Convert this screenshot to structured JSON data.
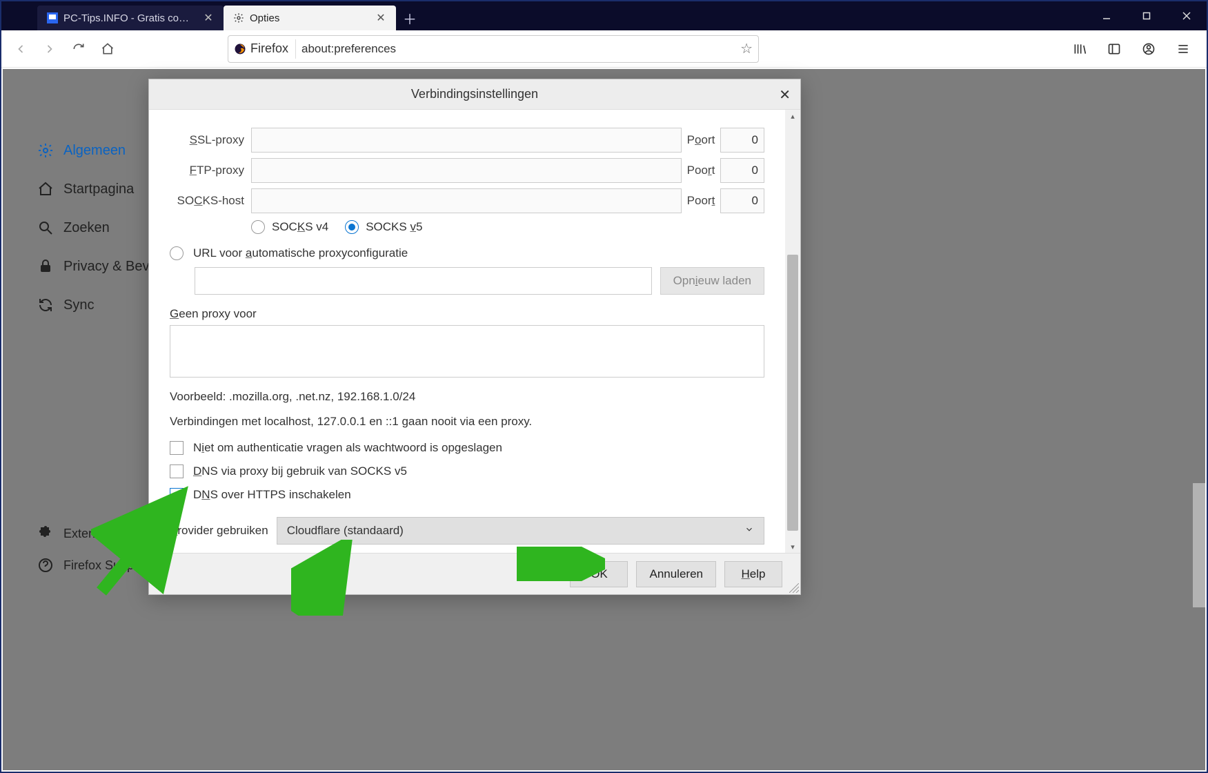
{
  "tabs": {
    "t1": {
      "title": "PC-Tips.INFO - Gratis compute"
    },
    "t2": {
      "title": "Opties"
    }
  },
  "urlbar": {
    "identity": "Firefox",
    "url": "about:preferences"
  },
  "sidebar": {
    "general": "Algemeen",
    "home": "Startpagina",
    "search": "Zoeken",
    "privacy": "Privacy & Beve",
    "sync": "Sync",
    "extensions": "Extensies & T",
    "support": "Firefox Support"
  },
  "dialog": {
    "title": "Verbindingsinstellingen",
    "ssl_label": "SSL-proxy",
    "ftp_label": "FTP-proxy",
    "socks_label": "SOCKS-host",
    "port_label": "Poort",
    "port_ssl": "0",
    "port_ftp": "0",
    "port_socks": "0",
    "socks_v4": "SOCKS v4",
    "socks_v5": "SOCKS v5",
    "auto_url_label": "URL voor automatische proxyconfiguratie",
    "reload": "Opnieuw laden",
    "noproxy_label": "Geen proxy voor",
    "example": "Voorbeeld: .mozilla.org, .net.nz, 192.168.1.0/24",
    "localhost_note": "Verbindingen met localhost, 127.0.0.1 en ::1 gaan nooit via een proxy.",
    "no_auth": "Niet om authenticatie vragen als wachtwoord is opgeslagen",
    "dns_proxy": "DNS via proxy bij gebruik van SOCKS v5",
    "dns_https": "DNS over HTTPS inschakelen",
    "provider_label": "Provider gebruiken",
    "provider_value": "Cloudflare (standaard)",
    "ok": "OK",
    "cancel": "Annuleren",
    "help": "Help"
  }
}
